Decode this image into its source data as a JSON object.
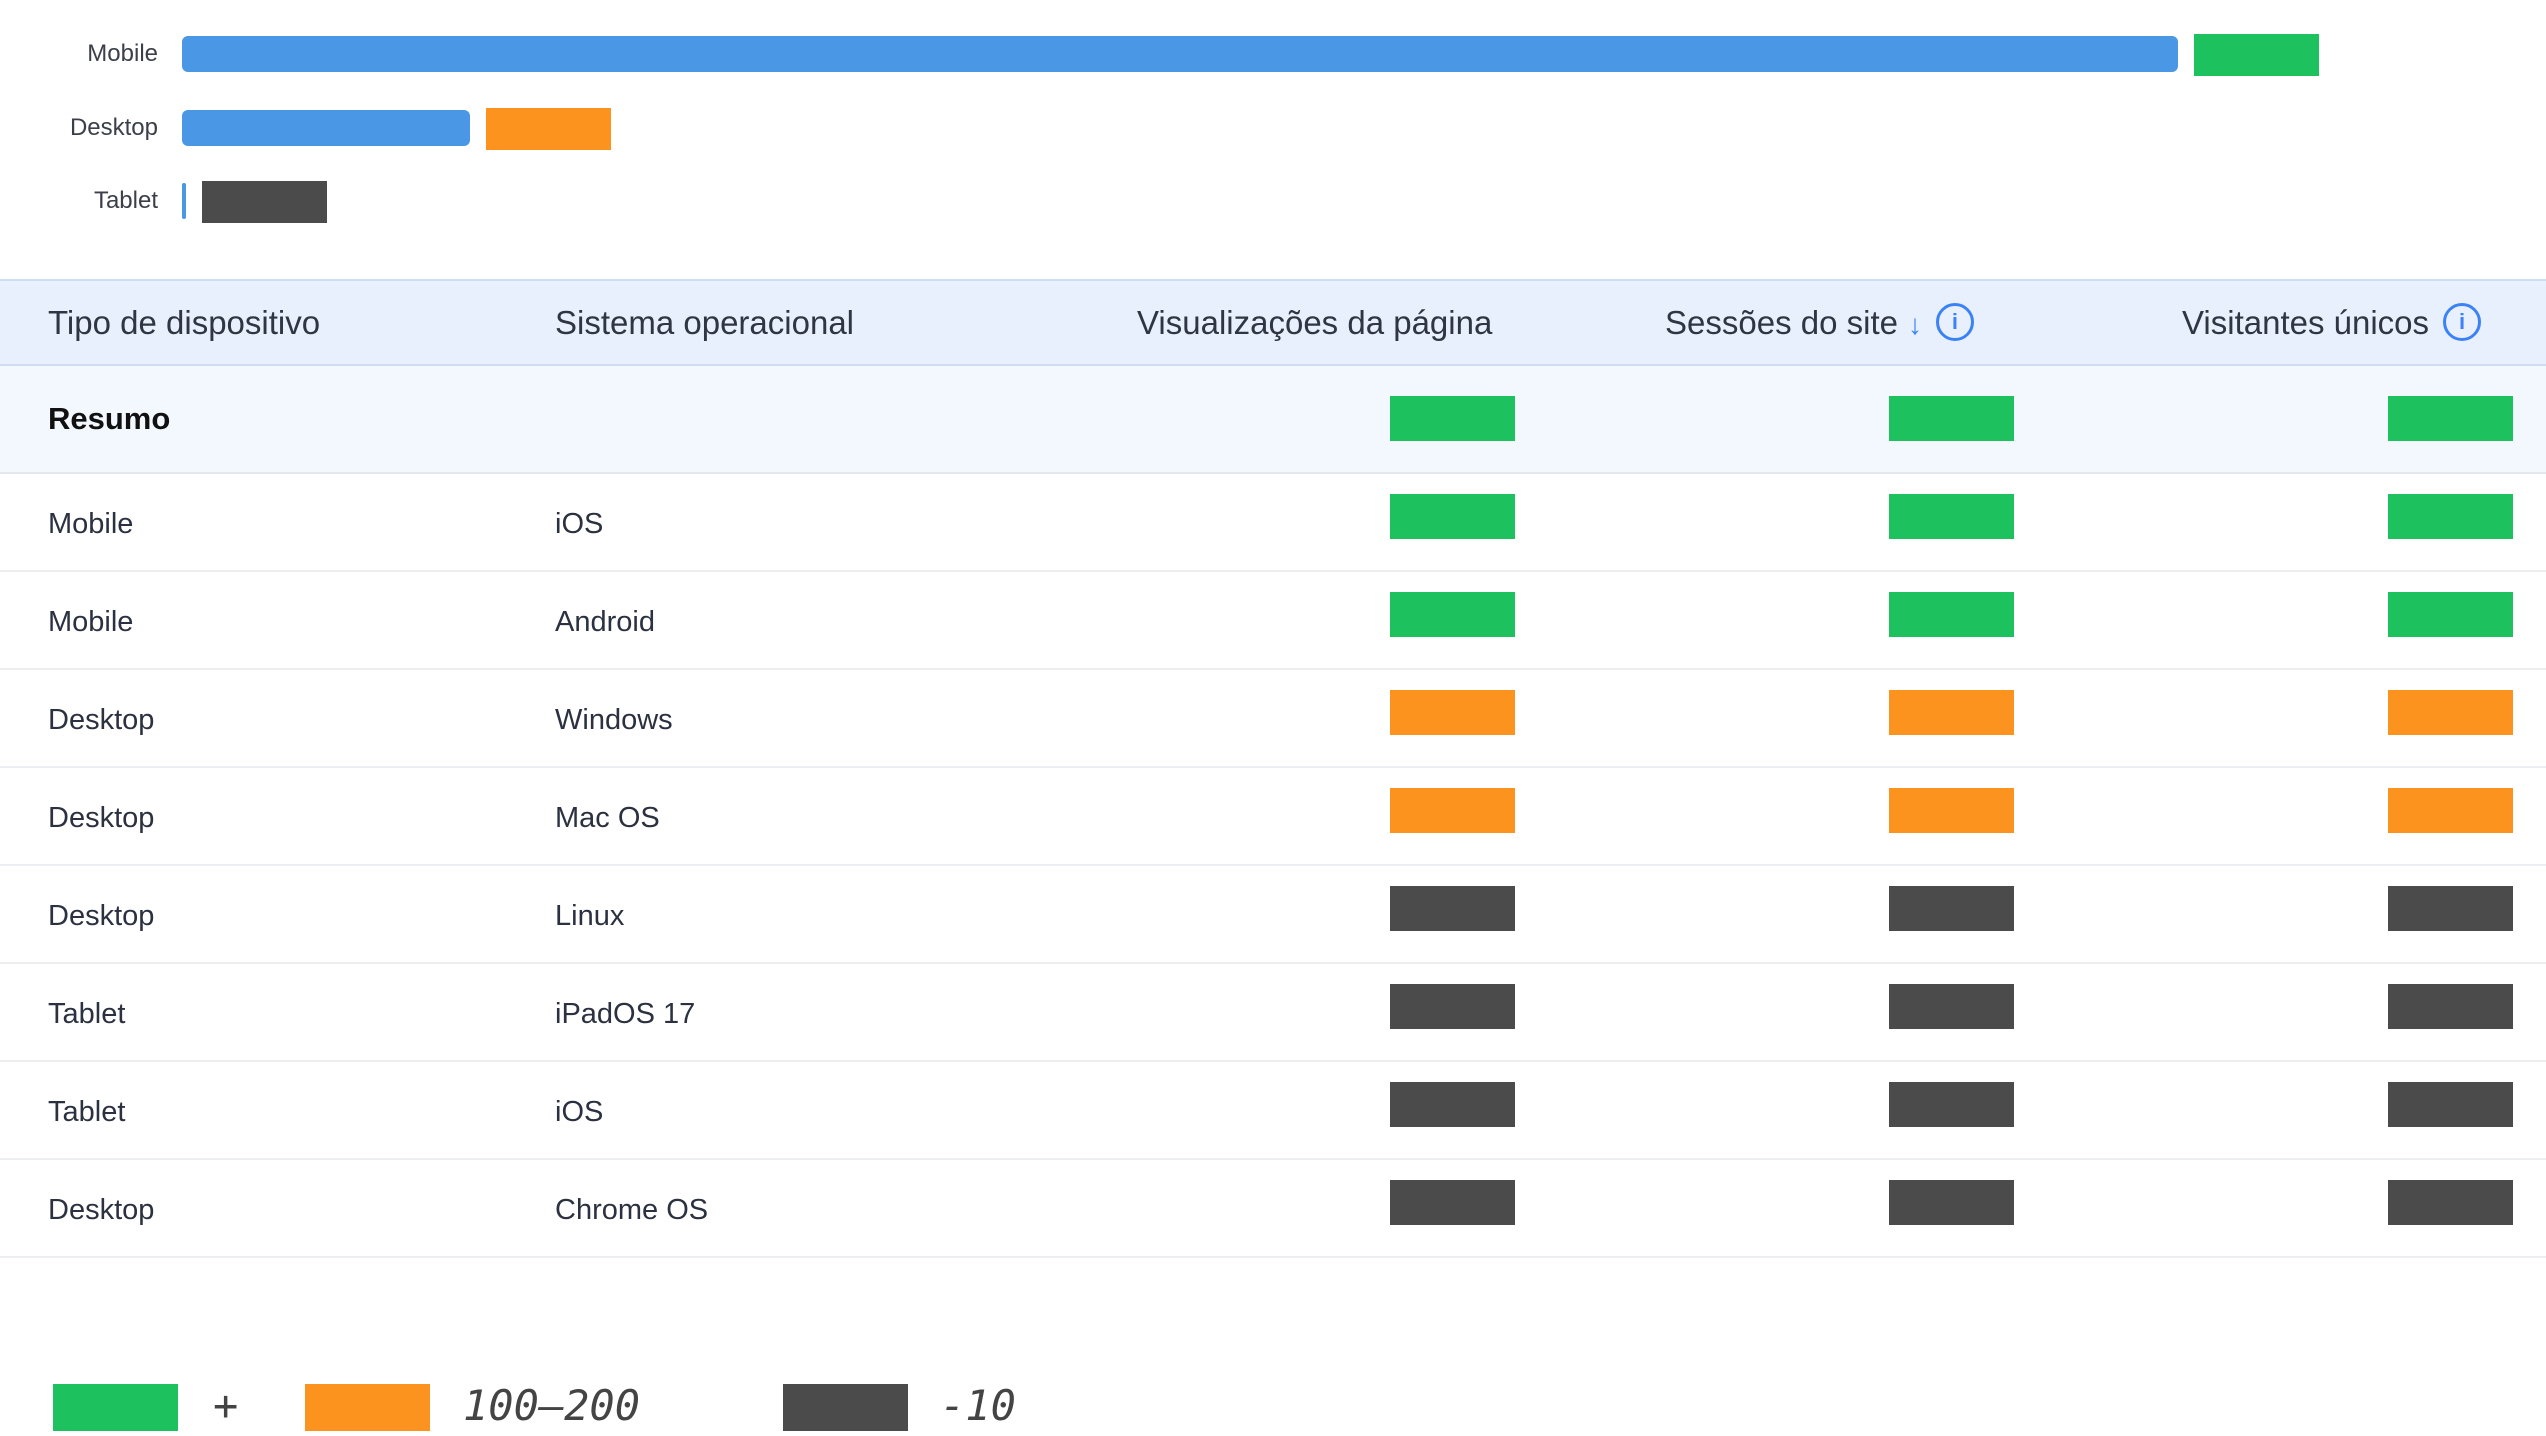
{
  "colors": {
    "good": "#1dc15e",
    "mid": "#fb931e",
    "low": "#4b4b4b",
    "bar": "#4a97e6"
  },
  "device_chart": {
    "rows": [
      {
        "label": "Mobile",
        "value_fraction": 0.9,
        "chip": "good"
      },
      {
        "label": "Desktop",
        "value_fraction": 0.13,
        "chip": "mid"
      },
      {
        "label": "Tablet",
        "value_fraction": 0.002,
        "chip": "low"
      }
    ]
  },
  "table": {
    "headers": {
      "device_type": "Tipo de dispositivo",
      "os": "Sistema operacional",
      "page_views": "Visualizações da página",
      "sessions": "Sessões do site",
      "sessions_sort": "↓",
      "sessions_info": "i",
      "unique_visitors": "Visitantes únicos",
      "unique_visitors_info": "i"
    },
    "summary": {
      "label": "Resumo",
      "page_views": "good",
      "sessions": "good",
      "unique_visitors": "good"
    },
    "rows": [
      {
        "device": "Mobile",
        "os": "iOS",
        "page_views": "good",
        "sessions": "good",
        "unique_visitors": "good"
      },
      {
        "device": "Mobile",
        "os": "Android",
        "page_views": "good",
        "sessions": "good",
        "unique_visitors": "good"
      },
      {
        "device": "Desktop",
        "os": "Windows",
        "page_views": "mid",
        "sessions": "mid",
        "unique_visitors": "mid"
      },
      {
        "device": "Desktop",
        "os": "Mac OS",
        "page_views": "mid",
        "sessions": "mid",
        "unique_visitors": "mid"
      },
      {
        "device": "Desktop",
        "os": "Linux",
        "page_views": "low",
        "sessions": "low",
        "unique_visitors": "low"
      },
      {
        "device": "Tablet",
        "os": "iPadOS 17",
        "page_views": "low",
        "sessions": "low",
        "unique_visitors": "low"
      },
      {
        "device": "Tablet",
        "os": "iOS",
        "page_views": "low",
        "sessions": "low",
        "unique_visitors": "low"
      },
      {
        "device": "Desktop",
        "os": "Chrome OS",
        "page_views": "low",
        "sessions": "low",
        "unique_visitors": "low"
      }
    ]
  },
  "legend": [
    {
      "key": "good",
      "label": "+"
    },
    {
      "key": "mid",
      "label": "100–200"
    },
    {
      "key": "low",
      "label": "-10"
    }
  ]
}
